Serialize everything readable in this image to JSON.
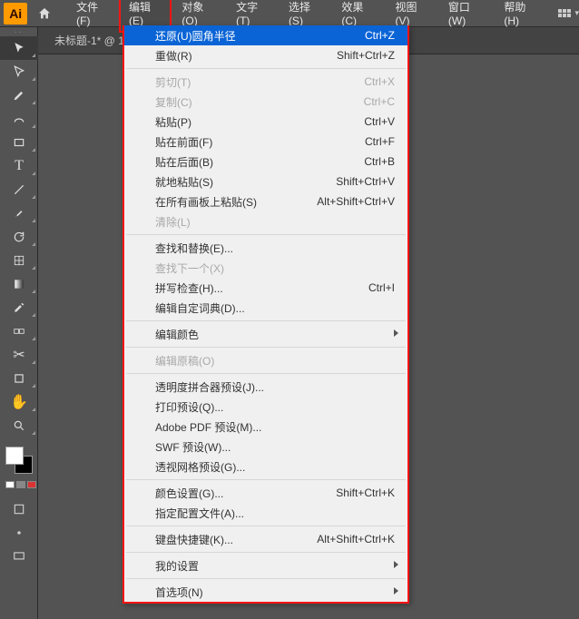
{
  "app": {
    "logo": "Ai"
  },
  "menubar": {
    "items": [
      "文件(F)",
      "编辑(E)",
      "对象(O)",
      "文字(T)",
      "选择(S)",
      "效果(C)",
      "视图(V)",
      "窗口(W)",
      "帮助(H)"
    ]
  },
  "tab": {
    "title": "未标题-1* @ 1"
  },
  "dropdown": {
    "groups": [
      [
        {
          "label": "还原(U)圆角半径",
          "shortcut": "Ctrl+Z",
          "hl": true
        },
        {
          "label": "重做(R)",
          "shortcut": "Shift+Ctrl+Z"
        }
      ],
      [
        {
          "label": "剪切(T)",
          "shortcut": "Ctrl+X",
          "dis": true
        },
        {
          "label": "复制(C)",
          "shortcut": "Ctrl+C",
          "dis": true
        },
        {
          "label": "粘贴(P)",
          "shortcut": "Ctrl+V"
        },
        {
          "label": "贴在前面(F)",
          "shortcut": "Ctrl+F"
        },
        {
          "label": "贴在后面(B)",
          "shortcut": "Ctrl+B"
        },
        {
          "label": "就地粘贴(S)",
          "shortcut": "Shift+Ctrl+V"
        },
        {
          "label": "在所有画板上粘贴(S)",
          "shortcut": "Alt+Shift+Ctrl+V"
        },
        {
          "label": "清除(L)",
          "dis": true
        }
      ],
      [
        {
          "label": "查找和替换(E)..."
        },
        {
          "label": "查找下一个(X)",
          "dis": true
        },
        {
          "label": "拼写检查(H)...",
          "shortcut": "Ctrl+I"
        },
        {
          "label": "编辑自定词典(D)..."
        }
      ],
      [
        {
          "label": "编辑颜色",
          "sub": true
        }
      ],
      [
        {
          "label": "编辑原稿(O)",
          "dis": true
        }
      ],
      [
        {
          "label": "透明度拼合器预设(J)..."
        },
        {
          "label": "打印预设(Q)..."
        },
        {
          "label": "Adobe PDF 预设(M)..."
        },
        {
          "label": "SWF 预设(W)..."
        },
        {
          "label": "透视网格预设(G)..."
        }
      ],
      [
        {
          "label": "颜色设置(G)...",
          "shortcut": "Shift+Ctrl+K"
        },
        {
          "label": "指定配置文件(A)..."
        }
      ],
      [
        {
          "label": "键盘快捷键(K)...",
          "shortcut": "Alt+Shift+Ctrl+K"
        }
      ],
      [
        {
          "label": "我的设置",
          "sub": true
        }
      ],
      [
        {
          "label": "首选项(N)",
          "sub": true
        }
      ]
    ]
  },
  "tools": {
    "list": [
      "selection",
      "direct-selection",
      "pen",
      "curvature",
      "rectangle",
      "type",
      "line",
      "brush",
      "rotate",
      "mesh",
      "gradient",
      "eyedropper",
      "blend",
      "scissors",
      "artboard",
      "hand",
      "zoom"
    ],
    "bottom": [
      "draw-mode",
      "screen-mode",
      "change-screen"
    ]
  }
}
